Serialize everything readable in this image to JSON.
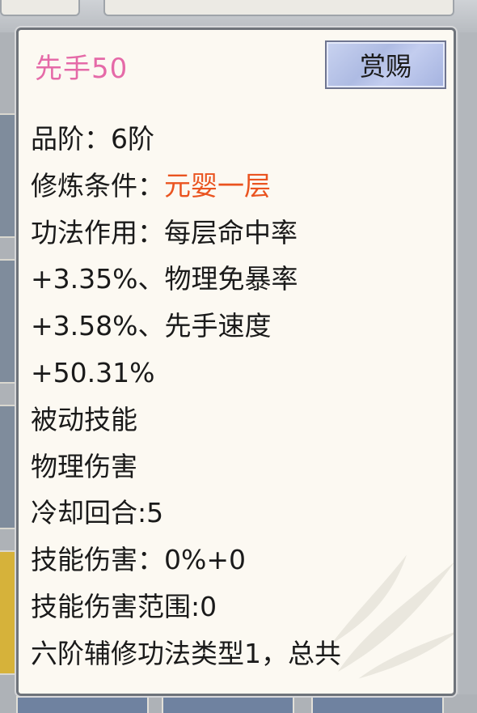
{
  "tooltip": {
    "title": "先手50",
    "reward_button_label": "赏赐",
    "grade_label": "品阶：",
    "grade_value": "6阶",
    "condition_label": "修炼条件：",
    "condition_value": "元婴一层",
    "lines": [
      "功法作用：每层命中率",
      "+3.35%、物理免暴率",
      "+3.58%、先手速度",
      "+50.31%",
      "被动技能",
      "物理伤害",
      "冷却回合:5",
      "技能伤害：0%+0",
      "技能伤害范围:0",
      "六阶辅修功法类型1，总共"
    ]
  },
  "colors": {
    "title": "#e56aa8",
    "highlight": "#ea5420",
    "text": "#1a1a1a"
  },
  "icons": {
    "watermark": "leaf-watermark-icon"
  }
}
